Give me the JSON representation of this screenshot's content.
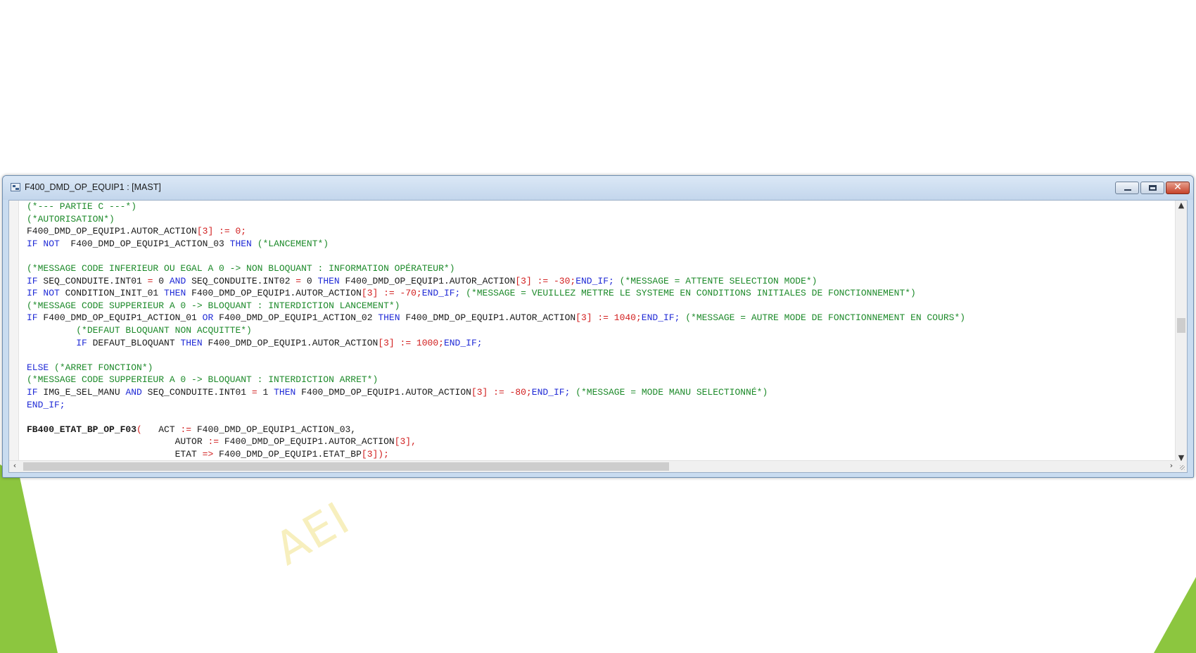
{
  "window": {
    "title": "F400_DMD_OP_EQUIP1 : [MAST]",
    "close_glyph": "✕"
  },
  "watermark": "AEI",
  "scrollbar": {
    "up": "▲",
    "down": "▼",
    "left": "‹",
    "right": "›"
  },
  "code_lines": [
    [
      [
        "c",
        "(*--- PARTIE C ---*)"
      ]
    ],
    [
      [
        "c",
        "(*AUTORISATION*)"
      ]
    ],
    [
      [
        "t",
        "F400_DMD_OP_EQUIP1.AUTOR_ACTION"
      ],
      [
        "o",
        "[3] := 0;"
      ]
    ],
    [
      [
        "k",
        "IF NOT"
      ],
      [
        "t",
        "  F400_DMD_OP_EQUIP1_ACTION_03 "
      ],
      [
        "k",
        "THEN"
      ],
      [
        "t",
        " "
      ],
      [
        "c",
        "(*LANCEMENT*)"
      ]
    ],
    [],
    [
      [
        "c",
        "(*MESSAGE CODE INFERIEUR OU EGAL A 0 -> NON BLOQUANT : INFORMATION OPÉRATEUR*)"
      ]
    ],
    [
      [
        "k",
        "IF"
      ],
      [
        "t",
        " SEQ_CONDUITE.INT01 "
      ],
      [
        "o",
        "="
      ],
      [
        "t",
        " 0 "
      ],
      [
        "k",
        "AND"
      ],
      [
        "t",
        " SEQ_CONDUITE.INT02 "
      ],
      [
        "o",
        "="
      ],
      [
        "t",
        " 0 "
      ],
      [
        "k",
        "THEN"
      ],
      [
        "t",
        " F400_DMD_OP_EQUIP1.AUTOR_ACTION"
      ],
      [
        "o",
        "[3] := -30;"
      ],
      [
        "k",
        "END_IF;"
      ],
      [
        "t",
        " "
      ],
      [
        "c",
        "(*MESSAGE = ATTENTE SELECTION MODE*)"
      ]
    ],
    [
      [
        "k",
        "IF NOT"
      ],
      [
        "t",
        " CONDITION_INIT_01 "
      ],
      [
        "k",
        "THEN"
      ],
      [
        "t",
        " F400_DMD_OP_EQUIP1.AUTOR_ACTION"
      ],
      [
        "o",
        "[3] := -70;"
      ],
      [
        "k",
        "END_IF;"
      ],
      [
        "t",
        " "
      ],
      [
        "c",
        "(*MESSAGE = VEUILLEZ METTRE LE SYSTEME EN CONDITIONS INITIALES DE FONCTIONNEMENT*)"
      ]
    ],
    [
      [
        "c",
        "(*MESSAGE CODE SUPPERIEUR A 0 -> BLOQUANT : INTERDICTION LANCEMENT*)"
      ]
    ],
    [
      [
        "k",
        "IF"
      ],
      [
        "t",
        " F400_DMD_OP_EQUIP1_ACTION_01 "
      ],
      [
        "k",
        "OR"
      ],
      [
        "t",
        " F400_DMD_OP_EQUIP1_ACTION_02 "
      ],
      [
        "k",
        "THEN"
      ],
      [
        "t",
        " F400_DMD_OP_EQUIP1.AUTOR_ACTION"
      ],
      [
        "o",
        "[3] := 1040;"
      ],
      [
        "k",
        "END_IF;"
      ],
      [
        "t",
        " "
      ],
      [
        "c",
        "(*MESSAGE = AUTRE MODE DE FONCTIONNEMENT EN COURS*)"
      ]
    ],
    [
      [
        "t",
        "         "
      ],
      [
        "c",
        "(*DEFAUT BLOQUANT NON ACQUITTE*)"
      ]
    ],
    [
      [
        "t",
        "         "
      ],
      [
        "k",
        "IF"
      ],
      [
        "t",
        " DEFAUT_BLOQUANT "
      ],
      [
        "k",
        "THEN"
      ],
      [
        "t",
        " F400_DMD_OP_EQUIP1.AUTOR_ACTION"
      ],
      [
        "o",
        "[3] := 1000;"
      ],
      [
        "k",
        "END_IF;"
      ]
    ],
    [],
    [
      [
        "k",
        "ELSE"
      ],
      [
        "t",
        " "
      ],
      [
        "c",
        "(*ARRET FONCTION*)"
      ]
    ],
    [
      [
        "c",
        "(*MESSAGE CODE SUPPERIEUR A 0 -> BLOQUANT : INTERDICTION ARRET*)"
      ]
    ],
    [
      [
        "k",
        "IF"
      ],
      [
        "t",
        " IMG_E_SEL_MANU "
      ],
      [
        "k",
        "AND"
      ],
      [
        "t",
        " SEQ_CONDUITE.INT01 "
      ],
      [
        "o",
        "="
      ],
      [
        "t",
        " 1 "
      ],
      [
        "k",
        "THEN"
      ],
      [
        "t",
        " F400_DMD_OP_EQUIP1.AUTOR_ACTION"
      ],
      [
        "o",
        "[3] := -80;"
      ],
      [
        "k",
        "END_IF;"
      ],
      [
        "t",
        " "
      ],
      [
        "c",
        "(*MESSAGE = MODE MANU SELECTIONNÉ*)"
      ]
    ],
    [
      [
        "k",
        "END_IF;"
      ]
    ],
    [],
    [
      [
        "b",
        "FB400_ETAT_BP_OP_F03"
      ],
      [
        "o",
        "("
      ],
      [
        "t",
        "   ACT "
      ],
      [
        "o",
        ":="
      ],
      [
        "t",
        " F400_DMD_OP_EQUIP1_ACTION_03,"
      ]
    ],
    [
      [
        "t",
        "                           AUTOR "
      ],
      [
        "o",
        ":="
      ],
      [
        "t",
        " F400_DMD_OP_EQUIP1.AUTOR_ACTION"
      ],
      [
        "o",
        "[3],"
      ]
    ],
    [
      [
        "t",
        "                           ETAT "
      ],
      [
        "o",
        "=>"
      ],
      [
        "t",
        " F400_DMD_OP_EQUIP1.ETAT_BP"
      ],
      [
        "o",
        "[3]);"
      ]
    ]
  ]
}
